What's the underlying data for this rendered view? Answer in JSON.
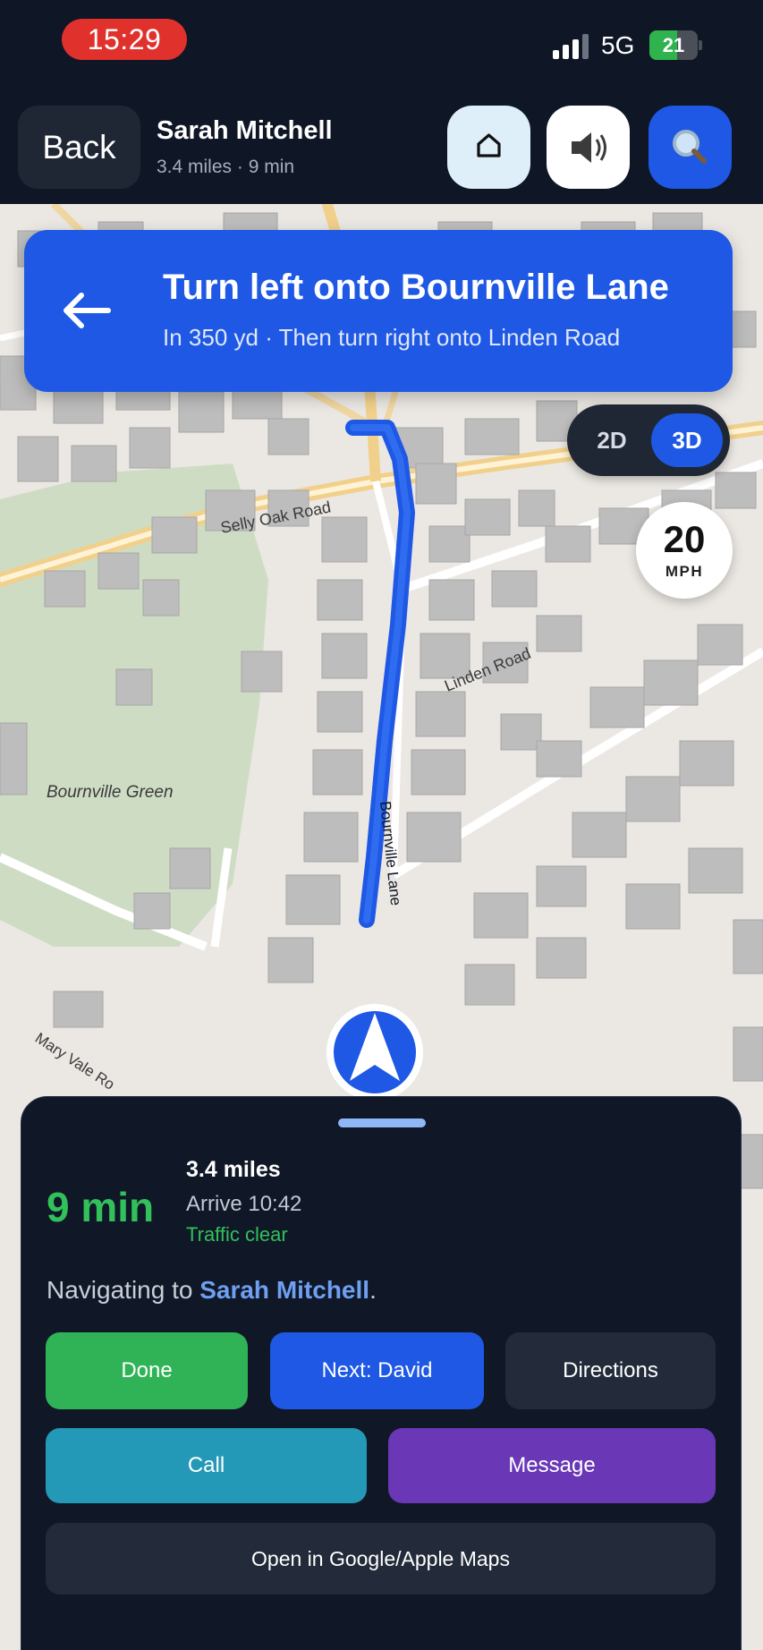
{
  "status_bar": {
    "time": "15:29",
    "network": "5G",
    "battery_text": "21",
    "battery_level": 0.21,
    "battery_color": "#2fb34f",
    "signal_bars_active": 3
  },
  "header": {
    "back_label": "Back",
    "contact_name": "Sarah Mitchell",
    "contact_meta": "3.4 miles · 9 min",
    "home_icon": "home-icon",
    "sound_icon": "speaker-icon",
    "search_icon": "search-icon"
  },
  "instruction": {
    "title": "Turn left onto Bournville Lane",
    "subtitle": "In 350 yd · Then turn right onto Linden Road",
    "icon": "arrow-left-icon"
  },
  "map": {
    "labels": {
      "selly_oak_road": "Selly Oak Road",
      "linden_road": "Linden Road",
      "bournville_green": "Bournville Green",
      "bournville_lane": "Bournville Lane",
      "mary_vale_road": "Mary Vale Ro"
    },
    "route_color": "#1e58e4",
    "view_toggle": {
      "option_2d": "2D",
      "option_3d": "3D",
      "active": "3D"
    },
    "speed_limit": {
      "value": "20",
      "unit": "MPH"
    }
  },
  "sheet": {
    "eta_duration": "9 min",
    "distance": "3.4 miles",
    "arrival": "Arrive 10:42",
    "traffic": "Traffic clear",
    "navigating_prefix": "Navigating to ",
    "navigating_target": "Sarah Mitchell",
    "navigating_suffix": ".",
    "buttons": {
      "done": "Done",
      "next": "Next: David",
      "directions": "Directions",
      "call": "Call",
      "message": "Message",
      "open_maps": "Open in Google/Apple Maps"
    }
  },
  "colors": {
    "accent_blue": "#1e58e4",
    "success_green": "#2fb356",
    "call_teal": "#2499b7",
    "message_purple": "#6a37b6",
    "dark_panel": "#101828"
  }
}
